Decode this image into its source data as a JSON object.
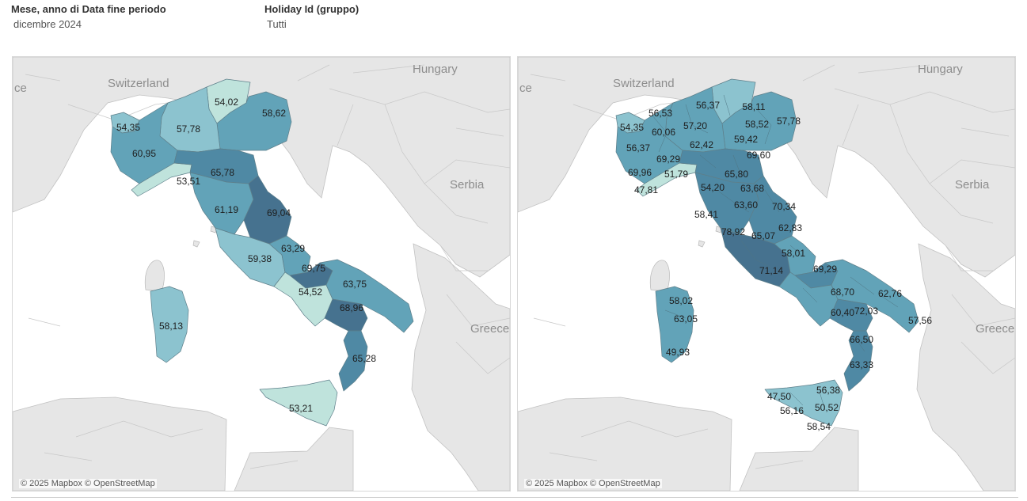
{
  "filters": [
    {
      "label": "Mese, anno di Data fine periodo",
      "value": "dicembre 2024"
    },
    {
      "label": "Holiday Id (gruppo)",
      "value": "Tutti"
    }
  ],
  "maps": [
    {
      "attribution": "© 2025 Mapbox © OpenStreetMap",
      "country_labels": [
        "Switzerland",
        "Hungary",
        "Serbia",
        "Greece",
        "ce"
      ],
      "values": [
        "54,02",
        "58,62",
        "54,35",
        "57,78",
        "60,95",
        "53,51",
        "65,78",
        "61,19",
        "69,04",
        "63,29",
        "59,38",
        "69,75",
        "54,52",
        "63,75",
        "68,96",
        "65,28",
        "58,13",
        "53,21"
      ]
    },
    {
      "attribution": "© 2025 Mapbox © OpenStreetMap",
      "country_labels": [
        "Switzerland",
        "Hungary",
        "Serbia",
        "Greece",
        "ce"
      ],
      "values": [
        "56,37",
        "58,11",
        "56,53",
        "60,06",
        "57,20",
        "58,52",
        "57,78",
        "54,35",
        "56,37",
        "62,42",
        "59,42",
        "69,60",
        "69,29",
        "69,96",
        "51,79",
        "65,80",
        "47,81",
        "54,20",
        "63,68",
        "63,60",
        "70,34",
        "58,41",
        "78,92",
        "65,07",
        "62,83",
        "58,01",
        "71,14",
        "69,29",
        "68,70",
        "62,76",
        "60,40",
        "72,03",
        "57,56",
        "58,02",
        "63,05",
        "49,93",
        "66,50",
        "63,33",
        "47,50",
        "56,38",
        "56,16",
        "50,52",
        "58,54"
      ]
    }
  ],
  "colors": {
    "light": "#bfe3dc",
    "mid_light": "#8cc3cf",
    "mid": "#62a3b8",
    "mid_dark": "#4f89a4",
    "dark": "#46728f"
  }
}
